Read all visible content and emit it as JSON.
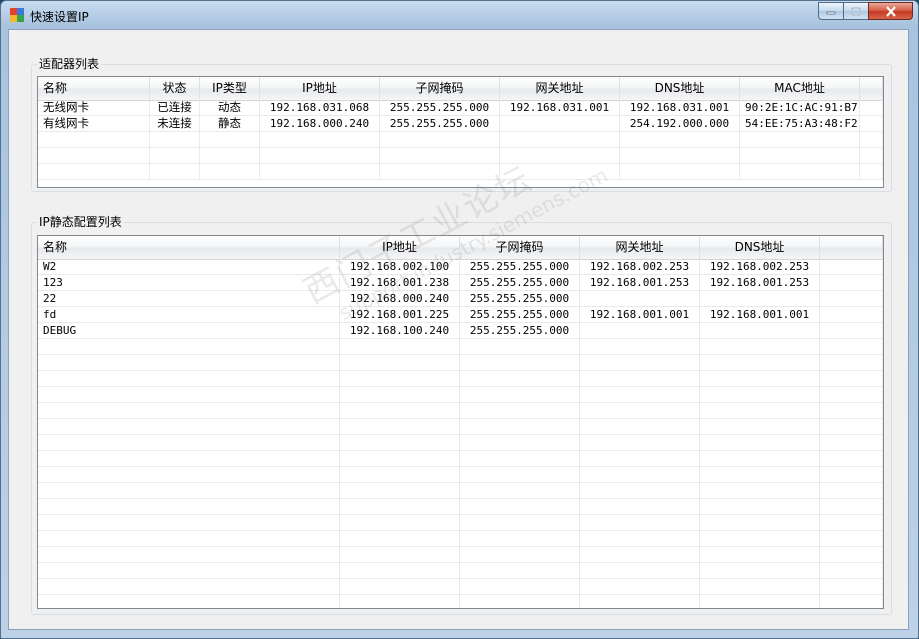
{
  "window": {
    "title": "快速设置IP"
  },
  "adapter_group": {
    "label": "适配器列表",
    "columns": [
      "名称",
      "状态",
      "IP类型",
      "IP地址",
      "子网掩码",
      "网关地址",
      "DNS地址",
      "MAC地址"
    ],
    "rows": [
      [
        "无线网卡",
        "已连接",
        "动态",
        "192.168.031.068",
        "255.255.255.000",
        "192.168.031.001",
        "192.168.031.001",
        "90:2E:1C:AC:91:B7"
      ],
      [
        "有线网卡",
        "未连接",
        "静态",
        "192.168.000.240",
        "255.255.255.000",
        "",
        "254.192.000.000",
        "54:EE:75:A3:48:F2"
      ]
    ]
  },
  "static_group": {
    "label": "IP静态配置列表",
    "columns": [
      "名称",
      "IP地址",
      "子网掩码",
      "网关地址",
      "DNS地址"
    ],
    "rows": [
      [
        "W2",
        "192.168.002.100",
        "255.255.255.000",
        "192.168.002.253",
        "192.168.002.253"
      ],
      [
        "123",
        "192.168.001.238",
        "255.255.255.000",
        "192.168.001.253",
        "192.168.001.253"
      ],
      [
        "22",
        "192.168.000.240",
        "255.255.255.000",
        "",
        ""
      ],
      [
        "fd",
        "192.168.001.225",
        "255.255.255.000",
        "192.168.001.001",
        "192.168.001.001"
      ],
      [
        "DEBUG",
        "192.168.100.240",
        "255.255.255.000",
        "",
        ""
      ]
    ]
  },
  "watermark": {
    "line1": "西门子工业论坛",
    "line2": "support.industry.siemens.com"
  }
}
